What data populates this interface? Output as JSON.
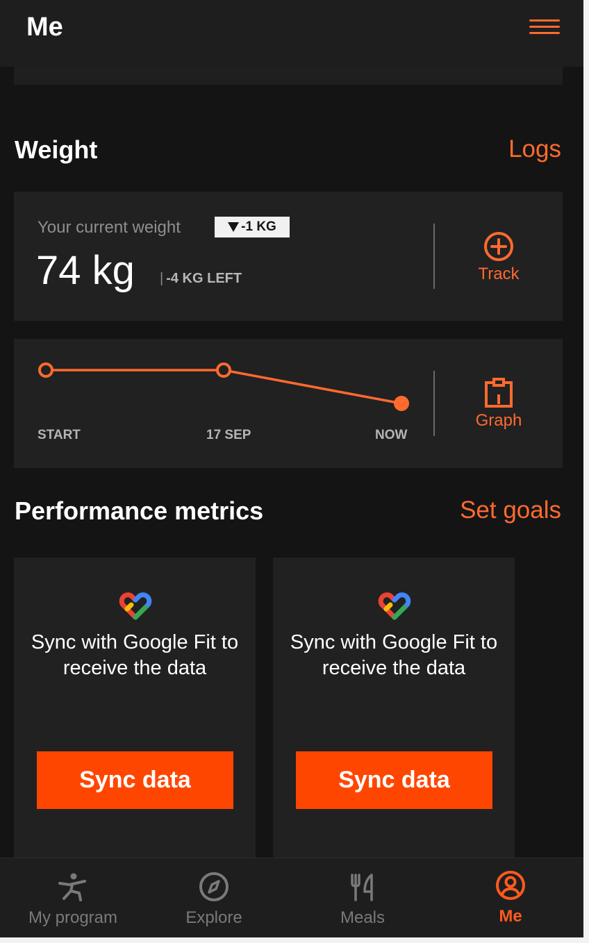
{
  "header": {
    "title": "Me"
  },
  "weight_section": {
    "title": "Weight",
    "link": "Logs",
    "current_label": "Your current weight",
    "delta_badge": "-1 KG",
    "current_value": "74 kg",
    "remaining_separator": "|",
    "remaining": "-4 KG LEFT",
    "track_label": "Track",
    "graph_label": "Graph"
  },
  "chart_data": {
    "type": "line",
    "categories": [
      "START",
      "17 SEP",
      "NOW"
    ],
    "series": [
      {
        "values": [
          75,
          75,
          74
        ]
      }
    ]
  },
  "performance_section": {
    "title": "Performance metrics",
    "link": "Set goals",
    "cards": [
      {
        "text": "Sync with Google Fit to receive the data",
        "button": "Sync data"
      },
      {
        "text": "Sync with Google Fit to receive the data",
        "button": "Sync data"
      }
    ]
  },
  "bottom_nav": {
    "items": [
      {
        "label": "My program",
        "icon": "person-exercise-icon"
      },
      {
        "label": "Explore",
        "icon": "compass-icon"
      },
      {
        "label": "Meals",
        "icon": "fork-knife-icon"
      },
      {
        "label": "Me",
        "icon": "user-circle-icon",
        "active": true
      }
    ]
  },
  "colors": {
    "accent": "#ff6a2f",
    "button": "#ff4600",
    "background": "#141414",
    "card": "#212121"
  }
}
